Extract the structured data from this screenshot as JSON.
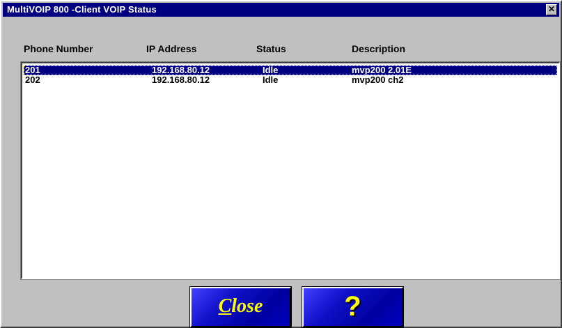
{
  "window": {
    "title": "MultiVOIP 800 -Client VOIP Status",
    "close_glyph": "✕"
  },
  "columns": [
    "Phone Number",
    "IP Address",
    "Status",
    "Description"
  ],
  "rows": [
    {
      "phone": "201",
      "ip": "192.168.80.12",
      "status": "Idle",
      "description": "mvp200 2.01E",
      "selected": true
    },
    {
      "phone": "202",
      "ip": "192.168.80.12",
      "status": "Idle",
      "description": "mvp200 ch2",
      "selected": false
    }
  ],
  "buttons": {
    "close_label": "Close",
    "help_label": "?"
  },
  "colors": {
    "titlebar": "#000080",
    "selection": "#000080",
    "button_text": "#ffff00",
    "button_face": "#1010c8"
  }
}
